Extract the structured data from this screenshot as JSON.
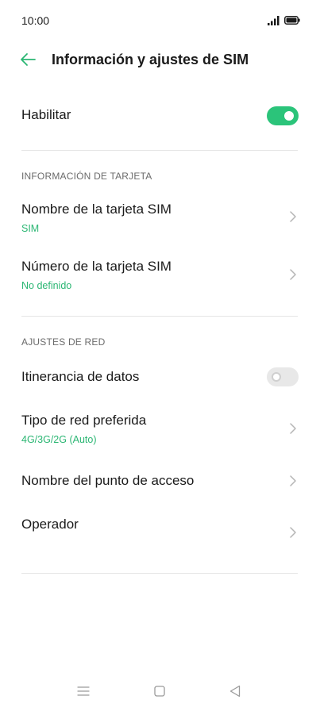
{
  "status_bar": {
    "time": "10:00"
  },
  "header": {
    "title": "Información y ajustes de SIM"
  },
  "enable": {
    "label": "Habilitar",
    "on": true
  },
  "card_info": {
    "section_title": "INFORMACIÓN DE TARJETA",
    "sim_name": {
      "label": "Nombre de la tarjeta SIM",
      "value": "SIM"
    },
    "sim_number": {
      "label": "Número de la tarjeta SIM",
      "value": "No definido"
    }
  },
  "network": {
    "section_title": "AJUSTES DE RED",
    "roaming": {
      "label": "Itinerancia de datos",
      "on": false
    },
    "preferred_network": {
      "label": "Tipo de red preferida",
      "value": "4G/3G/2G (Auto)"
    },
    "apn": {
      "label": "Nombre del punto de acceso"
    },
    "operator": {
      "label": "Operador"
    }
  },
  "colors": {
    "accent": "#2bb673",
    "toggle_on": "#2bc47a",
    "divider": "#e6e6e6"
  },
  "icons": {
    "back": "arrow-left",
    "chevron": "chevron-right",
    "nav_menu": "three-lines",
    "nav_home": "square",
    "nav_back": "triangle-left"
  }
}
